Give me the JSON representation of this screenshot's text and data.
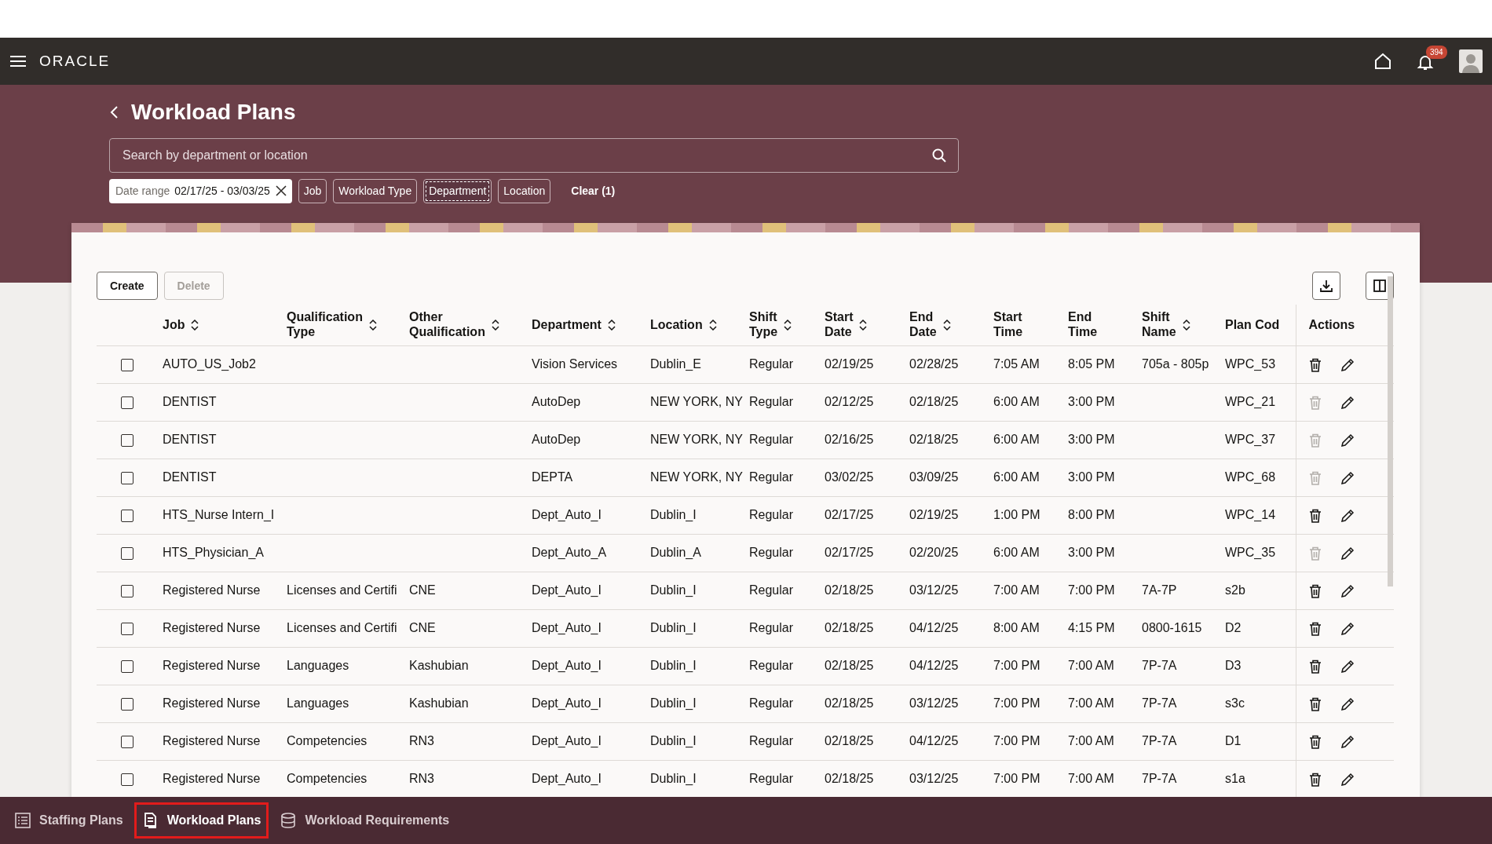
{
  "app_bar": {
    "logo": "ORACLE",
    "notification_count": "394"
  },
  "page": {
    "title": "Workload Plans"
  },
  "search": {
    "placeholder": "Search by department or location"
  },
  "filters": [
    {
      "kind": "range",
      "label": "Date range",
      "value": "02/17/25 - 03/03/25"
    },
    {
      "kind": "chip",
      "label": "Job",
      "selected": false
    },
    {
      "kind": "chip",
      "label": "Workload Type",
      "selected": false
    },
    {
      "kind": "chip",
      "label": "Department",
      "selected": true
    },
    {
      "kind": "chip",
      "label": "Location",
      "selected": false
    },
    {
      "kind": "clear",
      "label": "Clear (1)"
    }
  ],
  "toolbar": {
    "buttons": [
      {
        "label": "Create",
        "disabled": false
      },
      {
        "label": "Delete",
        "disabled": true
      }
    ]
  },
  "table": {
    "columns": [
      {
        "label": "Job",
        "sortable": true
      },
      {
        "label": "Qualification Type",
        "sortable": true
      },
      {
        "label": "Other Qualification",
        "sortable": true
      },
      {
        "label": "Department",
        "sortable": true
      },
      {
        "label": "Location",
        "sortable": true
      },
      {
        "label": "Shift Type",
        "sortable": true
      },
      {
        "label": "Start Date",
        "sortable": true
      },
      {
        "label": "End Date",
        "sortable": true
      },
      {
        "label": "Start Time",
        "sortable": false
      },
      {
        "label": "End Time",
        "sortable": false
      },
      {
        "label": "Shift Name",
        "sortable": true
      },
      {
        "label": "Plan Cod",
        "sortable": false
      },
      {
        "label": "Actions",
        "sortable": false
      }
    ],
    "rows": [
      {
        "checked": false,
        "deletable": true,
        "cells": [
          "AUTO_US_Job2",
          "",
          "",
          "Vision Services",
          "Dublin_E",
          "Regular",
          "02/19/25",
          "02/28/25",
          "7:05 AM",
          "8:05 PM",
          "705a - 805p",
          "WPC_53"
        ]
      },
      {
        "checked": false,
        "deletable": false,
        "cells": [
          "DENTIST",
          "",
          "",
          "AutoDep",
          "NEW YORK, NY",
          "Regular",
          "02/12/25",
          "02/18/25",
          "6:00 AM",
          "3:00 PM",
          "",
          "WPC_21"
        ]
      },
      {
        "checked": false,
        "deletable": false,
        "cells": [
          "DENTIST",
          "",
          "",
          "AutoDep",
          "NEW YORK, NY",
          "Regular",
          "02/16/25",
          "02/18/25",
          "6:00 AM",
          "3:00 PM",
          "",
          "WPC_37"
        ]
      },
      {
        "checked": false,
        "deletable": false,
        "cells": [
          "DENTIST",
          "",
          "",
          "DEPTA",
          "NEW YORK, NY",
          "Regular",
          "03/02/25",
          "03/09/25",
          "6:00 AM",
          "3:00 PM",
          "",
          "WPC_68"
        ]
      },
      {
        "checked": false,
        "deletable": true,
        "cells": [
          "HTS_Nurse Intern_I",
          "",
          "",
          "Dept_Auto_I",
          "Dublin_I",
          "Regular",
          "02/17/25",
          "02/19/25",
          "1:00 PM",
          "8:00 PM",
          "",
          "WPC_14"
        ]
      },
      {
        "checked": false,
        "deletable": false,
        "cells": [
          "HTS_Physician_A",
          "",
          "",
          "Dept_Auto_A",
          "Dublin_A",
          "Regular",
          "02/17/25",
          "02/20/25",
          "6:00 AM",
          "3:00 PM",
          "",
          "WPC_35"
        ]
      },
      {
        "checked": false,
        "deletable": true,
        "cells": [
          "Registered Nurse",
          "Licenses and Certifi",
          "CNE",
          "Dept_Auto_I",
          "Dublin_I",
          "Regular",
          "02/18/25",
          "03/12/25",
          "7:00 AM",
          "7:00 PM",
          "7A-7P",
          "s2b"
        ]
      },
      {
        "checked": false,
        "deletable": true,
        "cells": [
          "Registered Nurse",
          "Licenses and Certifi",
          "CNE",
          "Dept_Auto_I",
          "Dublin_I",
          "Regular",
          "02/18/25",
          "04/12/25",
          "8:00 AM",
          "4:15 PM",
          "0800-1615",
          "D2"
        ]
      },
      {
        "checked": false,
        "deletable": true,
        "cells": [
          "Registered Nurse",
          "Languages",
          "Kashubian",
          "Dept_Auto_I",
          "Dublin_I",
          "Regular",
          "02/18/25",
          "04/12/25",
          "7:00 PM",
          "7:00 AM",
          "7P-7A",
          "D3"
        ]
      },
      {
        "checked": false,
        "deletable": true,
        "cells": [
          "Registered Nurse",
          "Languages",
          "Kashubian",
          "Dept_Auto_I",
          "Dublin_I",
          "Regular",
          "02/18/25",
          "03/12/25",
          "7:00 PM",
          "7:00 AM",
          "7P-7A",
          "s3c"
        ]
      },
      {
        "checked": false,
        "deletable": true,
        "cells": [
          "Registered Nurse",
          "Competencies",
          "RN3",
          "Dept_Auto_I",
          "Dublin_I",
          "Regular",
          "02/18/25",
          "04/12/25",
          "7:00 PM",
          "7:00 AM",
          "7P-7A",
          "D1"
        ]
      },
      {
        "checked": false,
        "deletable": true,
        "cells": [
          "Registered Nurse",
          "Competencies",
          "RN3",
          "Dept_Auto_I",
          "Dublin_I",
          "Regular",
          "02/18/25",
          "03/12/25",
          "7:00 PM",
          "7:00 AM",
          "7P-7A",
          "s1a"
        ]
      }
    ]
  },
  "bottom_tabs": [
    {
      "label": "Staffing Plans",
      "kind": "list",
      "selected": false
    },
    {
      "label": "Workload Plans",
      "kind": "document",
      "selected": true
    },
    {
      "label": "Workload Requirements",
      "kind": "database",
      "selected": false
    }
  ]
}
